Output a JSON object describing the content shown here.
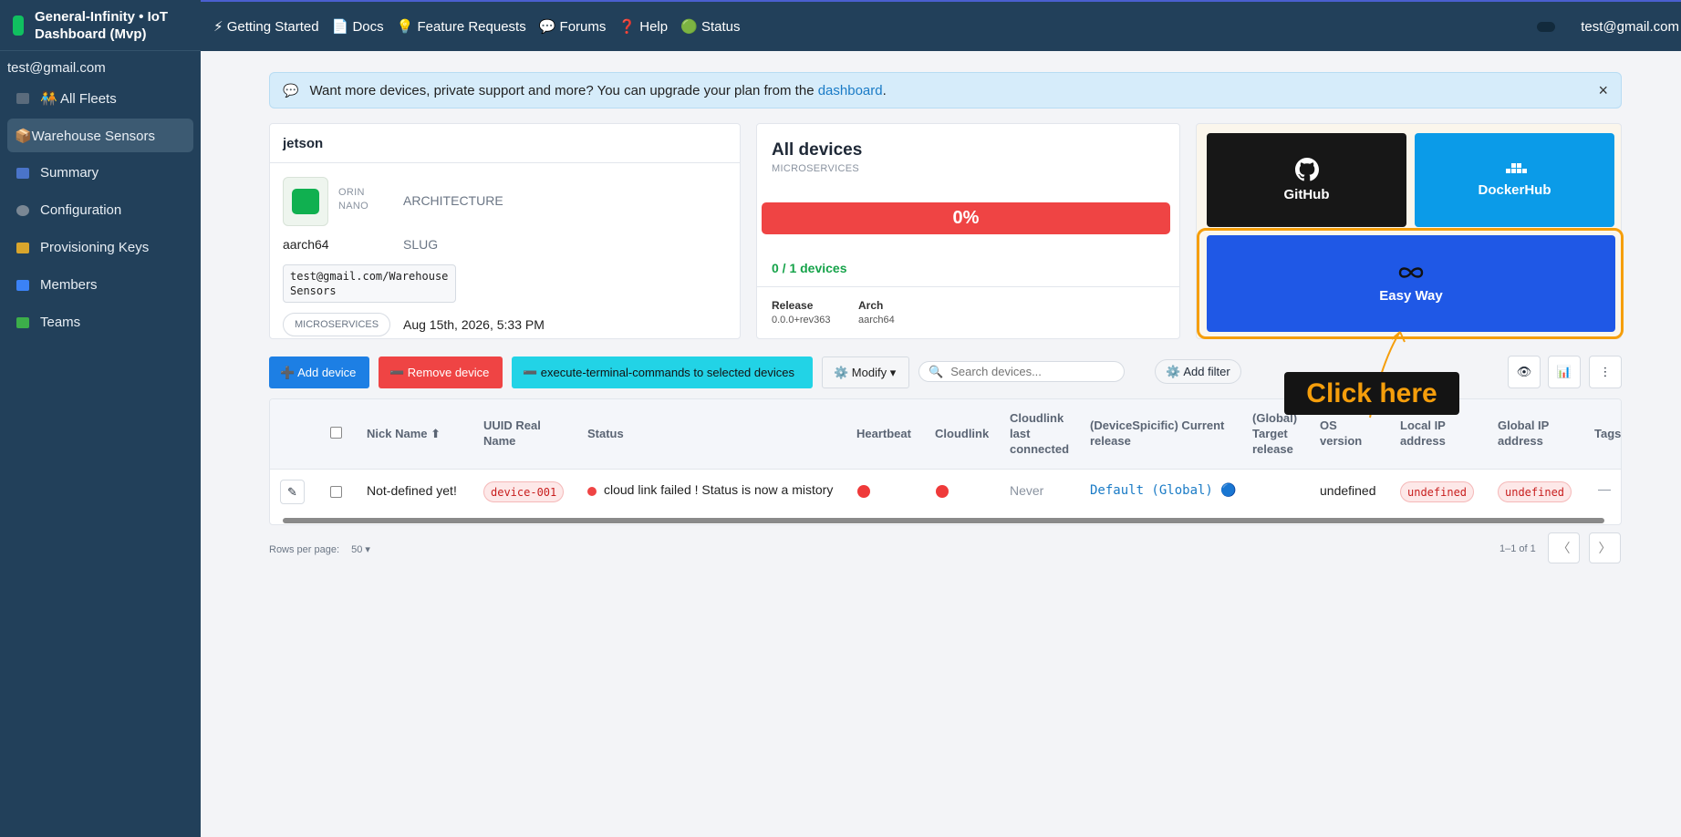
{
  "app": {
    "name": "General-Infinity • IoT Dashboard (Mvp)",
    "brand_color": "#10c060"
  },
  "sidebar": {
    "user": "test@gmail.com",
    "items": [
      {
        "label": "🧑‍🤝‍🧑 All Fleets",
        "icon": "fleet-icon",
        "active": false
      },
      {
        "label": "📦Warehouse Sensors",
        "icon": "package-icon",
        "active": true
      },
      {
        "label": "Summary",
        "icon": "chart-icon",
        "active": false
      },
      {
        "label": "Configuration",
        "icon": "gear-icon",
        "active": false
      },
      {
        "label": "Provisioning Keys",
        "icon": "key-icon",
        "active": false
      },
      {
        "label": "Members",
        "icon": "members-icon",
        "active": false
      },
      {
        "label": "Teams",
        "icon": "puzzle-icon",
        "active": false
      }
    ]
  },
  "topbar": {
    "links": [
      "⚡ Getting Started",
      "📄 Docs",
      "💡 Feature Requests",
      "💬 Forums",
      "❓ Help",
      "🟢 Status"
    ],
    "user": "test@gmail.com"
  },
  "banner": {
    "text": "Want more devices, private support and more? You can upgrade your plan from the",
    "link": "dashboard",
    "suffix": ".",
    "close": "×"
  },
  "fleet_card": {
    "title": "jetson",
    "model_line1": "ORIN",
    "model_line2": "NANO",
    "architecture_label": "ARCHITECTURE",
    "arch_value": "aarch64",
    "slug_label": "SLUG",
    "slug_line1": "test@gmail.com/Warehouse",
    "slug_line2": "Sensors",
    "type_pill": "MICROSERVICES",
    "date": "Aug 15th, 2026, 5:33 PM"
  },
  "devices_card": {
    "title": "All devices",
    "subtitle": "MICROSERVICES",
    "progress_label": "0%",
    "progress_value": 0,
    "count": "0 / 1 devices",
    "release_label": "Release",
    "release_value": "0.0.0+rev363",
    "arch_label": "Arch",
    "arch_value": "aarch64"
  },
  "link_tiles": {
    "github": "GitHub",
    "dockerhub": "DockerHub",
    "easyway": "Easy Way"
  },
  "toolbar": {
    "add": "➕ Add device",
    "remove": "➖ Remove device",
    "execute": "➖ execute-terminal-commands to selected devices",
    "modify": "⚙️ Modify ▾",
    "search_placeholder": "Search devices...",
    "add_filter": "⚙️ Add filter",
    "view_icon": "👁",
    "chart_icon": "📊",
    "more_icon": "⋮"
  },
  "annotation": {
    "label": "Click here",
    "color": "#f59e0b"
  },
  "table": {
    "headers": {
      "nick": "Nick Name ⬆",
      "uuid_1": "UUID Real",
      "uuid_2": "Name",
      "status": "Status",
      "heartbeat": "Heartbeat",
      "cloudlink": "Cloudlink",
      "last_1": "Cloudlink",
      "last_2": "last",
      "last_3": "connected",
      "current_1": "(DeviceSpicific) Current",
      "current_2": "release",
      "target_1": "(Global)",
      "target_2": "Target",
      "target_3": "release",
      "os_1": "OS",
      "os_2": "version",
      "local_1": "Local IP",
      "local_2": "address",
      "global_1": "Global IP",
      "global_2": "address",
      "tags": "Tags"
    },
    "rows": [
      {
        "nick": "Not-defined yet!",
        "uuid": "device-001",
        "status": "cloud link failed ! Status is now a mistory",
        "last_connected": "Never",
        "current_release": "Default (Global) 🔵",
        "os_version": "undefined",
        "local_ip": "undefined",
        "global_ip": "undefined",
        "tags": "—"
      }
    ]
  },
  "pagination": {
    "rows_per_page_label": "Rows per page:",
    "rows_per_page_value": "50 ▾",
    "range": "1–1 of 1",
    "prev": "〈",
    "next": "〉"
  },
  "colors": {
    "sidebar_bg": "#22405a",
    "danger": "#ef4444",
    "primary": "#1d7fe4",
    "cyan": "#22d3e6",
    "success": "#16a34a"
  }
}
